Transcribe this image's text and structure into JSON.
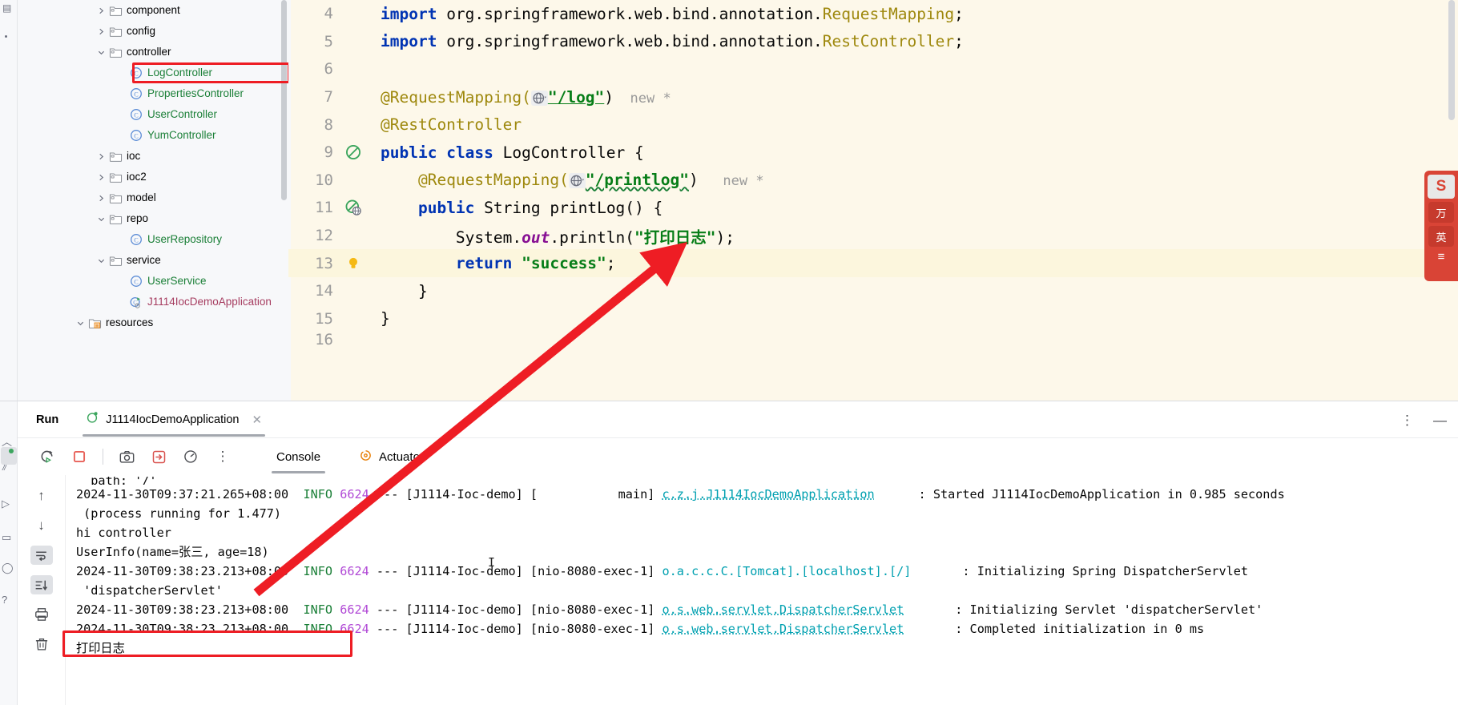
{
  "project_tree": {
    "items": [
      {
        "label": "component",
        "type": "folder",
        "indent": 0,
        "chevron": "right"
      },
      {
        "label": "config",
        "type": "folder",
        "indent": 0,
        "chevron": "right"
      },
      {
        "label": "controller",
        "type": "folder",
        "indent": 0,
        "chevron": "down"
      },
      {
        "label": "LogController",
        "type": "class",
        "indent": 1,
        "chevron": "none",
        "highlighted": true
      },
      {
        "label": "PropertiesController",
        "type": "class",
        "indent": 1,
        "chevron": "none"
      },
      {
        "label": "UserController",
        "type": "class",
        "indent": 1,
        "chevron": "none"
      },
      {
        "label": "YumController",
        "type": "class",
        "indent": 1,
        "chevron": "none"
      },
      {
        "label": "ioc",
        "type": "folder",
        "indent": 0,
        "chevron": "right"
      },
      {
        "label": "ioc2",
        "type": "folder",
        "indent": 0,
        "chevron": "right"
      },
      {
        "label": "model",
        "type": "folder",
        "indent": 0,
        "chevron": "right"
      },
      {
        "label": "repo",
        "type": "folder",
        "indent": 0,
        "chevron": "down"
      },
      {
        "label": "UserRepository",
        "type": "class",
        "indent": 1,
        "chevron": "none"
      },
      {
        "label": "service",
        "type": "folder",
        "indent": 0,
        "chevron": "down"
      },
      {
        "label": "UserService",
        "type": "class",
        "indent": 1,
        "chevron": "none"
      },
      {
        "label": "J1114IocDemoApplication",
        "type": "spring-app",
        "indent": 1,
        "chevron": "none"
      },
      {
        "label": "resources",
        "type": "resources-folder",
        "indent": -1,
        "chevron": "down"
      }
    ]
  },
  "editor": {
    "lines": [
      {
        "no": "4",
        "gutter": "none"
      },
      {
        "no": "5",
        "gutter": "none"
      },
      {
        "no": "6",
        "gutter": "none"
      },
      {
        "no": "7",
        "gutter": "none"
      },
      {
        "no": "8",
        "gutter": "none"
      },
      {
        "no": "9",
        "gutter": "no-usage-icon"
      },
      {
        "no": "10",
        "gutter": "none"
      },
      {
        "no": "11",
        "gutter": "web-mapping-icon"
      },
      {
        "no": "12",
        "gutter": "none"
      },
      {
        "no": "13",
        "gutter": "lightbulb-icon",
        "highlighted": true
      },
      {
        "no": "14",
        "gutter": "none"
      },
      {
        "no": "15",
        "gutter": "none"
      },
      {
        "no": "16",
        "gutter": "none"
      }
    ],
    "code": {
      "import_kw": "import",
      "import4_path": " org.springframework.web.bind.annotation.",
      "import4_cls": "RequestMapping",
      "import5_cls": "RestController",
      "semicolon": ";",
      "anno_requestmapping": "@RequestMapping(",
      "anno_restcontroller": "@RestController",
      "path_log": "\"/log\"",
      "path_printlog": "\"/printlog\"",
      "close_paren": ")",
      "hint_new": "new *",
      "kw_public": "public",
      "kw_class": "class",
      "cls_name": "LogController {",
      "kw_string": "String",
      "method_sig": "printLog() {",
      "sysout_prefix": "System.",
      "sysout_out": "out",
      "sysout_println": ".println(",
      "sysout_arg": "\"打印日志\"",
      "sysout_suffix": ");",
      "kw_return": "return",
      "return_val": "\"success\"",
      "return_semi": ";",
      "brace_close_inner": "}",
      "brace_close_outer": "}"
    }
  },
  "run_panel": {
    "title": "Run",
    "tab_label": "J1114IocDemoApplication",
    "tab_close": "✕",
    "header_more": "⋮",
    "header_minimize": "—",
    "toolbar": {
      "rerun": "rerun-icon",
      "stop": "stop-icon",
      "camera": "camera-icon",
      "thread_dump": "thread-dump-icon",
      "profiler": "profiler-icon",
      "more": "⋮",
      "tab_console": "Console",
      "tab_actuator": "Actuator"
    },
    "gutter": {
      "up": "↑",
      "down": "↓",
      "soft_wrap": "soft-wrap-icon",
      "scroll_end": "scroll-to-end-icon",
      "print": "print-icon",
      "clear": "trash-icon"
    }
  },
  "console": {
    "lines": [
      {
        "kind": "clipped",
        "segments": [
          {
            "t": "  path: '/'",
            "c": "l-plain"
          }
        ]
      },
      {
        "kind": "log",
        "segments": [
          {
            "t": "2024-11-30T09:37:21.265+08:00  ",
            "c": "l-plain"
          },
          {
            "t": "INFO",
            "c": "l-info"
          },
          {
            "t": " ",
            "c": "l-plain"
          },
          {
            "t": "6624",
            "c": "l-pid"
          },
          {
            "t": " --- [J1114-Ioc-demo] [           main] ",
            "c": "l-plain"
          },
          {
            "t": "c.z.j.J1114IocDemoApplication",
            "c": "l-cls-d"
          },
          {
            "t": "      : Started J1114IocDemoApplication in 0.985 seconds",
            "c": "l-plain"
          }
        ]
      },
      {
        "kind": "log",
        "segments": [
          {
            "t": " (process running for 1.477)",
            "c": "l-plain"
          }
        ]
      },
      {
        "kind": "log",
        "segments": [
          {
            "t": "hi controller",
            "c": "l-plain"
          }
        ]
      },
      {
        "kind": "log",
        "segments": [
          {
            "t": "UserInfo(name=张三, age=18)",
            "c": "l-plain"
          }
        ]
      },
      {
        "kind": "log",
        "segments": [
          {
            "t": "2024-11-30T09:38:23.213+08:00  ",
            "c": "l-plain"
          },
          {
            "t": "INFO",
            "c": "l-info"
          },
          {
            "t": " ",
            "c": "l-plain"
          },
          {
            "t": "6624",
            "c": "l-pid"
          },
          {
            "t": " --- [J1114-Ioc-demo] [nio-8080-exec-1] ",
            "c": "l-plain"
          },
          {
            "t": "o.a.c.c.C.[Tomcat].[localhost].[/]",
            "c": "l-cls"
          },
          {
            "t": "       : Initializing Spring DispatcherServlet",
            "c": "l-plain"
          }
        ]
      },
      {
        "kind": "log",
        "segments": [
          {
            "t": " 'dispatcherServlet'",
            "c": "l-plain"
          }
        ]
      },
      {
        "kind": "log",
        "segments": [
          {
            "t": "2024-11-30T09:38:23.213+08:00  ",
            "c": "l-plain"
          },
          {
            "t": "INFO",
            "c": "l-info"
          },
          {
            "t": " ",
            "c": "l-plain"
          },
          {
            "t": "6624",
            "c": "l-pid"
          },
          {
            "t": " --- [J1114-Ioc-demo] [nio-8080-exec-1] ",
            "c": "l-plain"
          },
          {
            "t": "o.s.web.servlet.DispatcherServlet",
            "c": "l-cls-d"
          },
          {
            "t": "       : Initializing Servlet 'dispatcherServlet'",
            "c": "l-plain"
          }
        ]
      },
      {
        "kind": "log",
        "segments": [
          {
            "t": "2024-11-30T09:38:23.213+08:00  ",
            "c": "l-plain"
          },
          {
            "t": "INFO",
            "c": "l-info"
          },
          {
            "t": " ",
            "c": "l-plain"
          },
          {
            "t": "6624",
            "c": "l-pid"
          },
          {
            "t": " --- [J1114-Ioc-demo] [nio-8080-exec-1] ",
            "c": "l-plain"
          },
          {
            "t": "o.s.web.servlet.DispatcherServlet",
            "c": "l-cls-d"
          },
          {
            "t": "       : Completed initialization in 0 ms",
            "c": "l-plain"
          }
        ]
      },
      {
        "kind": "log",
        "highlighted": true,
        "segments": [
          {
            "t": "打印日志",
            "c": "l-plain"
          }
        ]
      }
    ]
  },
  "sogou_widget": {
    "logo": "S",
    "pill_top": "万",
    "pill_mid": "英",
    "menu": "≡"
  },
  "colors": {
    "annotation_red": "#ee1d24",
    "editor_bg": "#fdf8ea",
    "panel_bg": "#f7f8fa",
    "string_green": "#067d17",
    "keyword_blue": "#0033b3",
    "annotation_yellow": "#9e880d"
  }
}
